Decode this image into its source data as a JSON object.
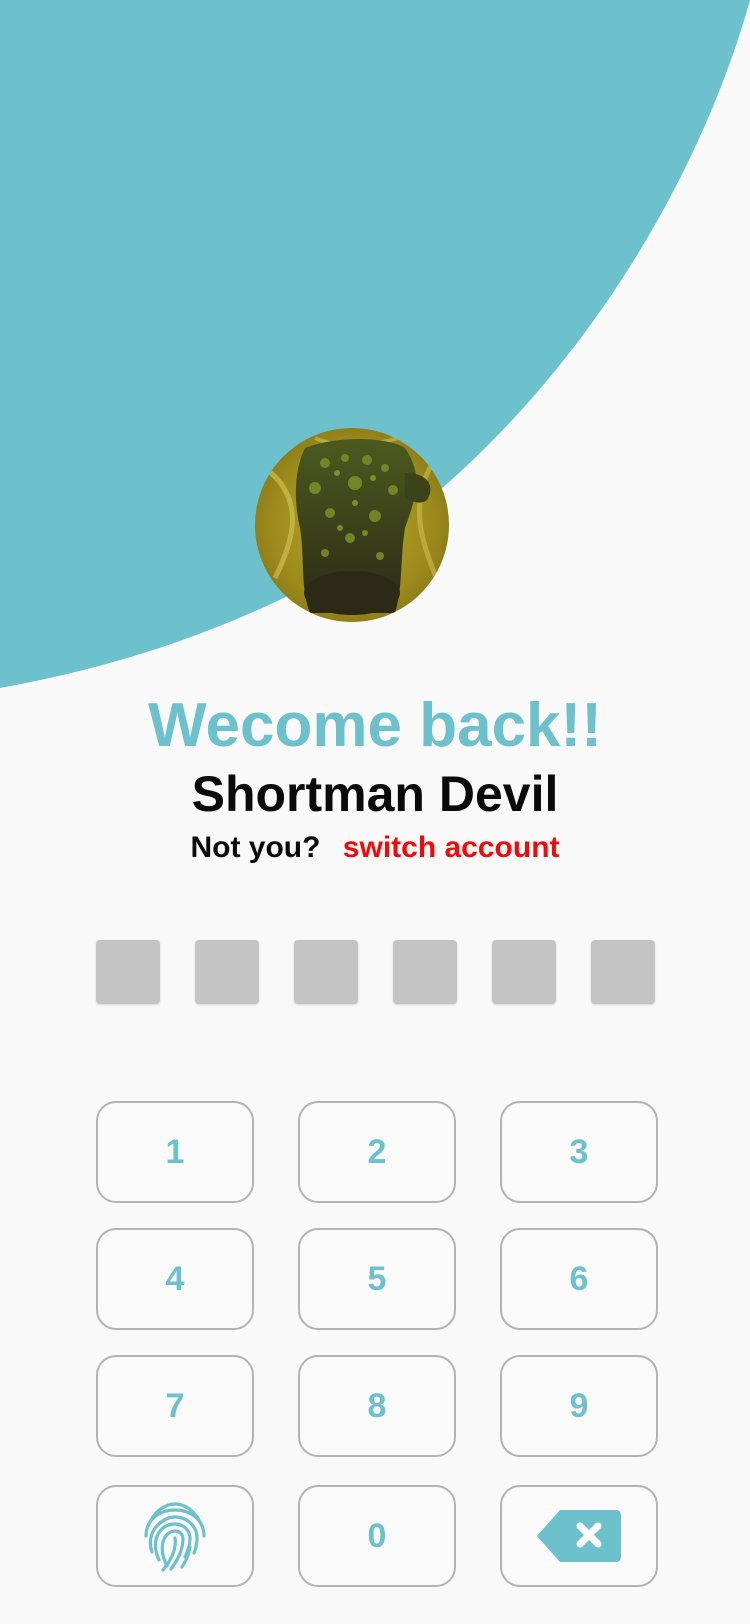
{
  "colors": {
    "accent": "#6dc1cd",
    "background": "#f9f9f9",
    "switch_link": "#f20a0a",
    "pin_box": "#c4c4c4",
    "key_border": "#b3b3b3"
  },
  "header": {
    "welcome": "Wecome back!!",
    "username": "Shortman Devil",
    "not_you": "Not you?",
    "switch_account": "switch account"
  },
  "avatar": {
    "icon": "crocodile-photo"
  },
  "pin": {
    "length": 6
  },
  "keypad": {
    "keys": [
      "1",
      "2",
      "3",
      "4",
      "5",
      "6",
      "7",
      "8",
      "9",
      "0"
    ],
    "fingerprint_icon": "fingerprint-icon",
    "backspace_icon": "backspace-icon"
  }
}
